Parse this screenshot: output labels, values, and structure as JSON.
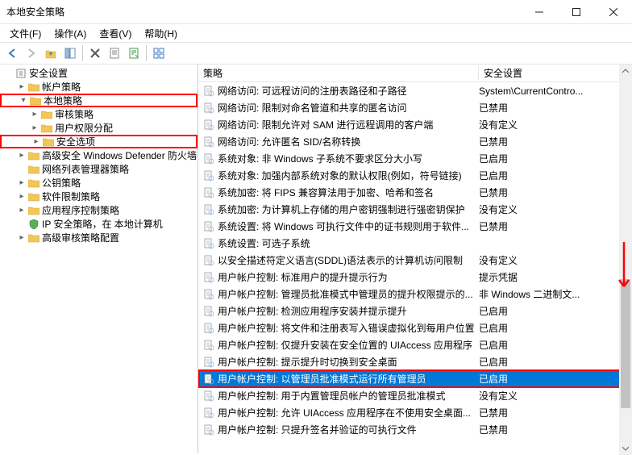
{
  "window": {
    "title": "本地安全策略"
  },
  "menu": {
    "file": "文件(F)",
    "action": "操作(A)",
    "view": "查看(V)",
    "help": "帮助(H)"
  },
  "tree": {
    "root": "安全设置",
    "items": [
      {
        "label": "帐户策略",
        "indent": 1,
        "expander": ">"
      },
      {
        "label": "本地策略",
        "indent": 1,
        "expander": "v",
        "highlight": true,
        "children": [
          {
            "label": "审核策略",
            "indent": 2,
            "expander": ">"
          },
          {
            "label": "用户权限分配",
            "indent": 2,
            "expander": ">"
          },
          {
            "label": "安全选项",
            "indent": 2,
            "expander": ">",
            "highlight": true
          }
        ]
      },
      {
        "label": "高级安全 Windows Defender 防火墙",
        "indent": 1,
        "expander": ">"
      },
      {
        "label": "网络列表管理器策略",
        "indent": 1,
        "expander": ""
      },
      {
        "label": "公钥策略",
        "indent": 1,
        "expander": ">"
      },
      {
        "label": "软件限制策略",
        "indent": 1,
        "expander": ">"
      },
      {
        "label": "应用程序控制策略",
        "indent": 1,
        "expander": ">"
      },
      {
        "label": "IP 安全策略，在 本地计算机",
        "indent": 1,
        "expander": "",
        "iconType": "shield"
      },
      {
        "label": "高级审核策略配置",
        "indent": 1,
        "expander": ">"
      }
    ]
  },
  "columns": {
    "policy": "策略",
    "setting": "安全设置"
  },
  "rows": [
    {
      "policy": "网络访问: 可远程访问的注册表路径和子路径",
      "setting": "System\\CurrentContro..."
    },
    {
      "policy": "网络访问: 限制对命名管道和共享的匿名访问",
      "setting": "已禁用"
    },
    {
      "policy": "网络访问: 限制允许对 SAM 进行远程调用的客户端",
      "setting": "没有定义"
    },
    {
      "policy": "网络访问: 允许匿名 SID/名称转换",
      "setting": "已禁用"
    },
    {
      "policy": "系统对象: 非 Windows 子系统不要求区分大小写",
      "setting": "已启用"
    },
    {
      "policy": "系统对象: 加强内部系统对象的默认权限(例如，符号链接)",
      "setting": "已启用"
    },
    {
      "policy": "系统加密: 将 FIPS 兼容算法用于加密、哈希和签名",
      "setting": "已禁用"
    },
    {
      "policy": "系统加密: 为计算机上存储的用户密钥强制进行强密钥保护",
      "setting": "没有定义"
    },
    {
      "policy": "系统设置: 将 Windows 可执行文件中的证书规则用于软件...",
      "setting": "已禁用"
    },
    {
      "policy": "系统设置: 可选子系统",
      "setting": ""
    },
    {
      "policy": "以安全描述符定义语言(SDDL)语法表示的计算机访问限制",
      "setting": "没有定义"
    },
    {
      "policy": "用户帐户控制: 标准用户的提升提示行为",
      "setting": "提示凭据"
    },
    {
      "policy": "用户帐户控制: 管理员批准模式中管理员的提升权限提示的...",
      "setting": "非 Windows 二进制文..."
    },
    {
      "policy": "用户帐户控制: 检测应用程序安装并提示提升",
      "setting": "已启用"
    },
    {
      "policy": "用户帐户控制: 将文件和注册表写入错误虚拟化到每用户位置",
      "setting": "已启用"
    },
    {
      "policy": "用户帐户控制: 仅提升安装在安全位置的 UIAccess 应用程序",
      "setting": "已启用"
    },
    {
      "policy": "用户帐户控制: 提示提升时切换到安全桌面",
      "setting": "已启用"
    },
    {
      "policy": "用户帐户控制: 以管理员批准模式运行所有管理员",
      "setting": "已启用",
      "selected": true,
      "highlight": true
    },
    {
      "policy": "用户帐户控制: 用于内置管理员帐户的管理员批准模式",
      "setting": "没有定义"
    },
    {
      "policy": "用户帐户控制: 允许 UIAccess 应用程序在不使用安全桌面...",
      "setting": "已禁用"
    },
    {
      "policy": "用户帐户控制: 只提升签名并验证的可执行文件",
      "setting": "已禁用"
    }
  ]
}
